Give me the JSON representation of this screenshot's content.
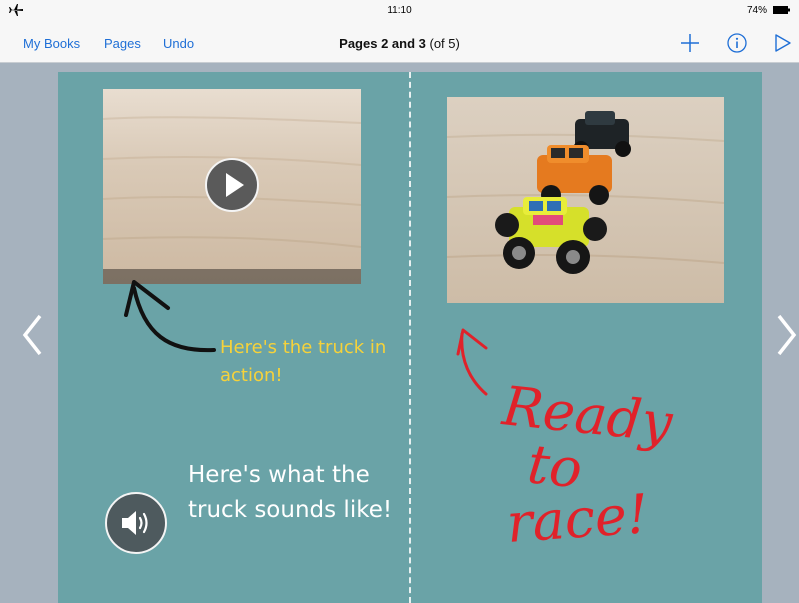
{
  "status_bar": {
    "time": "11:10",
    "battery_percent": "74%"
  },
  "nav": {
    "my_books": "My Books",
    "pages": "Pages",
    "undo": "Undo",
    "title_bold": "Pages 2 and 3",
    "title_rest": " (of 5)"
  },
  "left_page": {
    "caption": "Here's the truck in action!",
    "audio_text": "Here's what the truck sounds like!"
  },
  "right_page": {
    "handwriting": [
      "Ready",
      "to",
      "race!"
    ]
  },
  "colors": {
    "accent": "#1f6fd6",
    "page_background": "#6aa3a7",
    "caption_yellow": "#f6d23a",
    "ink_red": "#e0222a",
    "ink_black": "#111111"
  },
  "icons": [
    "airplane-icon",
    "battery-icon",
    "add-icon",
    "info-icon",
    "play-icon",
    "speaker-icon",
    "chevron-left-icon",
    "chevron-right-icon"
  ]
}
